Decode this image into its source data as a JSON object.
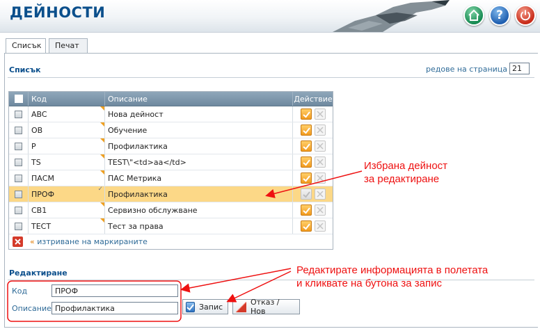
{
  "header": {
    "title": "ДЕЙНОСТИ",
    "help_glyph": "?"
  },
  "tabs": [
    {
      "label": "Списък"
    },
    {
      "label": "Печат"
    }
  ],
  "list_section": {
    "title": "Списък",
    "rows_per_page_label": "редове на страница",
    "rows_per_page_value": "21"
  },
  "grid": {
    "columns": {
      "code": "Код",
      "description": "Описание",
      "action": "Действие"
    },
    "rows": [
      {
        "code": "ABC",
        "description": "Нова дейност",
        "selected": false
      },
      {
        "code": "OB",
        "description": "Обучение",
        "selected": false
      },
      {
        "code": "P",
        "description": "Профилактика",
        "selected": false
      },
      {
        "code": "TS",
        "description": "TEST\\\"<td>aa</td>",
        "selected": false
      },
      {
        "code": "ПАСМ",
        "description": "ПАС Метрика",
        "selected": false
      },
      {
        "code": "ПРОФ",
        "description": "Профилактика",
        "selected": true
      },
      {
        "code": "СВ1",
        "description": "Сервизно обслужване",
        "selected": false
      },
      {
        "code": "ТЕСТ",
        "description": "Тест за права",
        "selected": false
      }
    ],
    "delete_marked_label": "изтриване на маркираните"
  },
  "edit_section": {
    "title": "Редактиране",
    "code_label": "Код",
    "code_value": "ПРОФ",
    "description_label": "Описание",
    "description_value": "Профилактика",
    "save_label": "Запис",
    "cancel_label": "Отказ / Нов"
  },
  "annotations": {
    "selected_line1": "Избрана дейност",
    "selected_line2": "за редактиране",
    "edit_line1": "Редактирате информацията в полетата",
    "edit_line2": "и кликвате на бутона за запис"
  },
  "colors": {
    "title": "#0b4f8c",
    "selected_row": "#fcd887",
    "annotation": "#ee1111",
    "edit_icon": "#f29a1e"
  },
  "icons": {
    "home": "home-icon",
    "help": "help-icon",
    "power": "power-icon",
    "edit": "edit-icon",
    "delete": "delete-icon",
    "save": "checkmark-icon",
    "cancel": "cancel-icon"
  }
}
